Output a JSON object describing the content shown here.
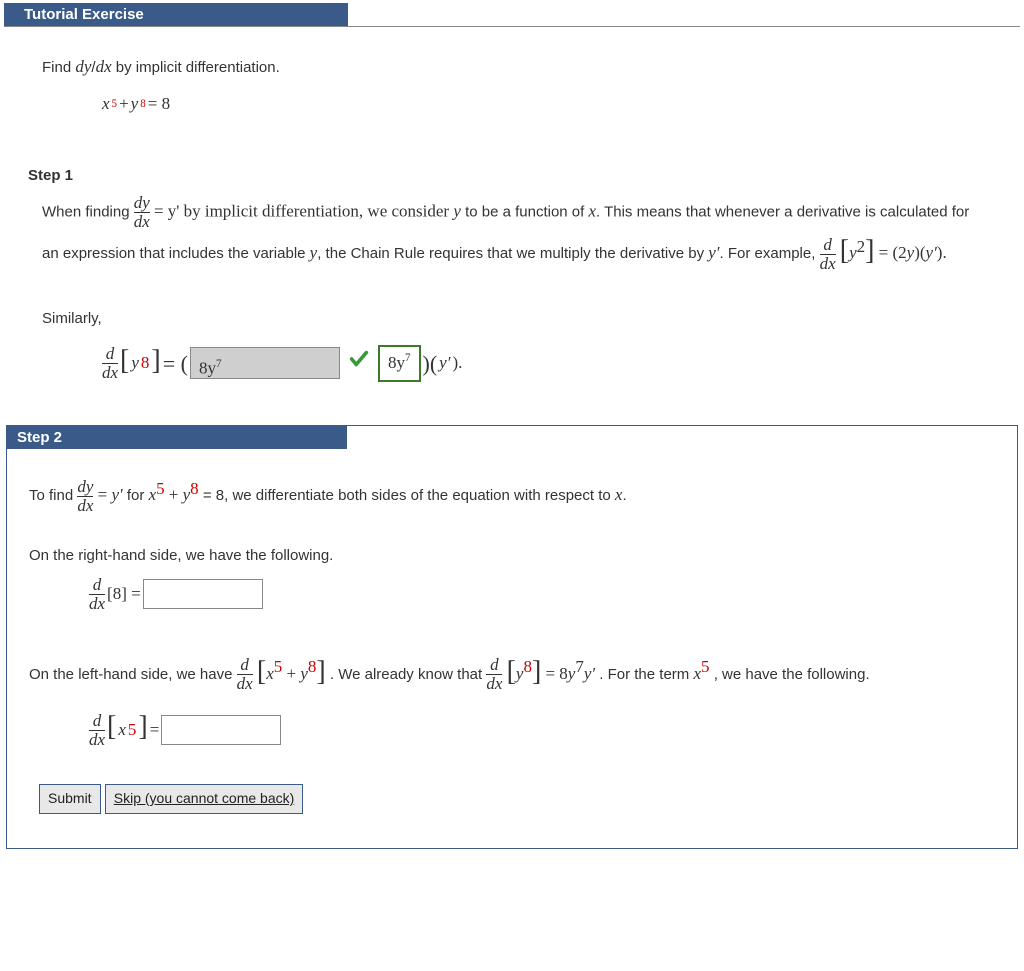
{
  "header": {
    "title": "Tutorial Exercise"
  },
  "problem": {
    "prompt": "Find dy/dx by implicit differentiation.",
    "eq_lhs_x_var": "x",
    "eq_lhs_x_exp": "5",
    "eq_plus": " + ",
    "eq_lhs_y_var": "y",
    "eq_lhs_y_exp": "8",
    "eq_rhs": " = 8"
  },
  "step1": {
    "title": "Step 1",
    "intro_a": "When finding ",
    "frac_dy": "dy",
    "frac_dx": "dx",
    "intro_b": " = y' by implicit differentiation, we consider ",
    "intro_b_var_y": "y",
    "intro_c": " to be a function of ",
    "intro_c_var_x": "x",
    "intro_d": ". This means that whenever a derivative is calculated for an expression that includes the variable ",
    "intro_d_var_y": "y",
    "intro_e": ", the Chain Rule requires that we multiply the derivative by ",
    "intro_e_yprime": "y′",
    "intro_f": ". For example, ",
    "ex_lb_y": "y",
    "ex_lb_exp": "2",
    "ex_eq": " = (2",
    "ex_eq_y": "y",
    "ex_eq2": ")(",
    "ex_eq_yp": "y′",
    "ex_eq3": ").",
    "similarly": "Similarly,",
    "sim_y": "y",
    "sim_exp": "8",
    "sim_eq_open": " = ( ",
    "locked_answer": "8y",
    "locked_answer_exp": "7",
    "correct_answer": "8y",
    "correct_answer_exp": "7",
    "sim_close": " )(",
    "sim_yp": "y′",
    "sim_close2": ")."
  },
  "step2": {
    "title": "Step 2",
    "p1_a": "To find ",
    "p1_b": " = ",
    "p1_yprime": "y′",
    "p1_c": " for ",
    "p1_xvar": "x",
    "p1_xexp": "5",
    "p1_plus": " + ",
    "p1_yvar": "y",
    "p1_yexp": "8",
    "p1_d": " = 8,  we differentiate both sides of the equation with respect to ",
    "p1_d_var": "x",
    "p1_e": ".",
    "p2": "On the right-hand side, we have the following.",
    "rhs_bracket": "[8] = ",
    "p3_a": "On the left-hand side, we have ",
    "p3_xvar": "x",
    "p3_xexp": "5",
    "p3_plus": " + ",
    "p3_yvar": "y",
    "p3_yexp": "8",
    "p3_b": ".  We already know that ",
    "p3_y2var": "y",
    "p3_y2exp": "8",
    "p3_c": " = 8",
    "p3_c_y": "y",
    "p3_c_exp": "7",
    "p3_c_yp": "y′",
    "p3_d": ". For the term ",
    "p3_x2var": "x",
    "p3_x2exp": "5",
    "p3_e": ",  we have the following.",
    "lhs_xvar": "x",
    "lhs_xexp": "5",
    "lhs_eq": " = ",
    "submit": "Submit",
    "skip": "Skip (you cannot come back)"
  },
  "chart_data": {
    "type": "table",
    "title": "Implicit Differentiation Tutorial — x^5 + y^8 = 8",
    "equation": "x^5 + y^8 = 8",
    "step1_example_given": "d/dx[y^2] = (2y)(y')",
    "step1_question": "d/dx[y^8] = ( ? )(y')",
    "step1_entered_answer": "8y^7",
    "step1_correct_answer": "8y^7",
    "step1_status": "correct",
    "step2_rhs_question": "d/dx[8] = (blank)",
    "step2_lhs_known": "d/dx[y^8] = 8y^7 y'",
    "step2_lhs_question": "d/dx[x^5] = (blank)"
  }
}
